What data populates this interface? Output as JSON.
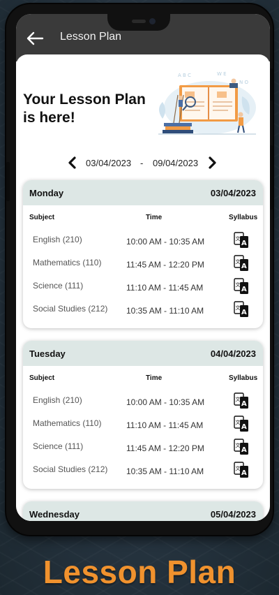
{
  "appbar": {
    "title": "Lesson Plan",
    "back_icon": "arrow-left-icon"
  },
  "hero": {
    "title_line1": "Your Lesson Plan",
    "title_line2": "is here!"
  },
  "week": {
    "from": "03/04/2023",
    "separator": "-",
    "to": "09/04/2023",
    "prev_icon": "chevron-left-icon",
    "next_icon": "chevron-right-icon"
  },
  "columns": {
    "subject": "Subject",
    "time": "Time",
    "syllabus": "Syllabus"
  },
  "days": [
    {
      "name": "Monday",
      "date": "03/04/2023",
      "rows": [
        {
          "subject": "English (210)",
          "time": "10:00 AM - 10:35 AM"
        },
        {
          "subject": "Mathematics (110)",
          "time": "11:45 AM - 12:20 PM"
        },
        {
          "subject": "Science (111)",
          "time": "11:10 AM - 11:45 AM"
        },
        {
          "subject": "Social Studies (212)",
          "time": "10:35 AM - 11:10 AM"
        }
      ]
    },
    {
      "name": "Tuesday",
      "date": "04/04/2023",
      "rows": [
        {
          "subject": "English (210)",
          "time": "10:00 AM - 10:35 AM"
        },
        {
          "subject": "Mathematics (110)",
          "time": "11:10 AM - 11:45 AM"
        },
        {
          "subject": "Science (111)",
          "time": "11:45 AM - 12:20 PM"
        },
        {
          "subject": "Social Studies (212)",
          "time": "10:35 AM - 11:10 AM"
        }
      ]
    },
    {
      "name": "Wednesday",
      "date": "05/04/2023"
    }
  ],
  "caption": "Lesson Plan",
  "colors": {
    "accent_caption": "#f0922e",
    "day_header": "#dde7e5",
    "appbar": "#3a3a3a"
  },
  "syllabus_icon": "translate-icon"
}
